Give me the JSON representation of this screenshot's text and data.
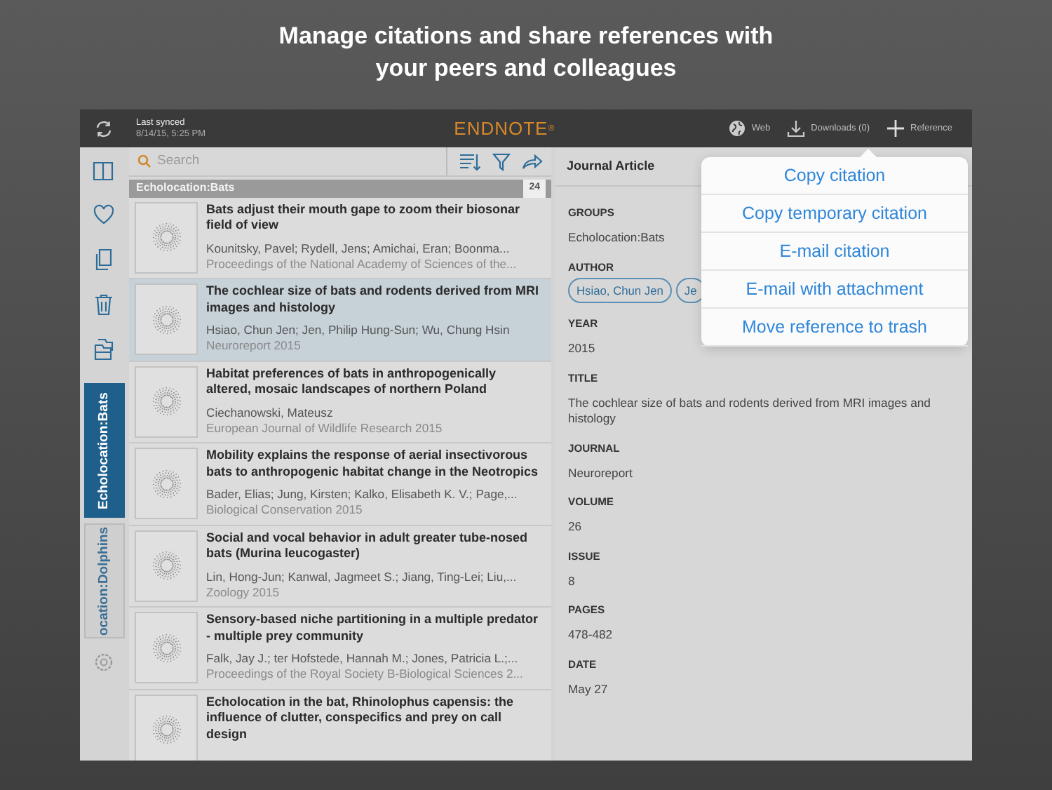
{
  "headline": "Manage citations and share references with your peers and colleagues",
  "top_bar": {
    "sync_label": "Last synced",
    "sync_time": "8/14/15, 5:25 PM",
    "logo": "ENDNOTE$^{®}$",
    "actions": [
      {
        "label": "Web",
        "kind": "web"
      },
      {
        "label": "Downloads (0)",
        "kind": "download"
      },
      {
        "label": "Reference",
        "kind": "add"
      }
    ]
  },
  "sidebar": {
    "groups": [
      {
        "label": "Echolocation:Bats",
        "selected": true
      },
      {
        "label": "ocation:Dolphins",
        "selected": false
      }
    ]
  },
  "list": {
    "search_placeholder": "Search",
    "group_title": "Echolocation:Bats",
    "count": "24",
    "references": [
      {
        "title": "Bats adjust their mouth gape to zoom their biosonar field of view",
        "authors": "Kounitsky, Pavel; Rydell, Jens; Amichai, Eran; Boonma...",
        "source": "Proceedings of the National Academy of Sciences of the...",
        "selected": false
      },
      {
        "title": "The cochlear size of bats and rodents derived from MRI images and histology",
        "authors": "Hsiao, Chun Jen; Jen, Philip Hung-Sun; Wu, Chung Hsin",
        "source": "Neuroreport 2015",
        "selected": true
      },
      {
        "title": "Habitat preferences of bats in anthropogenically altered, mosaic landscapes of northern Poland",
        "authors": "Ciechanowski, Mateusz",
        "source": "European Journal of Wildlife Research 2015",
        "selected": false
      },
      {
        "title": "Mobility explains the response of aerial insectivorous bats to anthropogenic habitat change in the Neotropics",
        "authors": "Bader, Elias; Jung, Kirsten; Kalko, Elisabeth K. V.; Page,...",
        "source": "Biological Conservation 2015",
        "selected": false
      },
      {
        "title": "Social and vocal behavior in adult greater tube-nosed bats (Murina leucogaster)",
        "authors": "Lin, Hong-Jun; Kanwal, Jagmeet S.; Jiang, Ting-Lei; Liu,...",
        "source": "Zoology 2015",
        "selected": false
      },
      {
        "title": "Sensory-based niche partitioning in a multiple predator - multiple prey community",
        "authors": "Falk, Jay J.; ter Hofstede, Hannah M.; Jones, Patricia L.;...",
        "source": "Proceedings of the Royal Society B-Biological Sciences 2...",
        "selected": false
      },
      {
        "title": "Echolocation in the bat, Rhinolophus capensis: the influence of clutter, conspecifics and prey on call design",
        "selected": false
      }
    ]
  },
  "detail": {
    "type": "Journal Article",
    "fields": [
      {
        "label": "GROUPS",
        "kind": "text",
        "value": "Echolocation:Bats"
      },
      {
        "label": "AUTHOR",
        "kind": "chips",
        "values": [
          "Hsiao, Chun Jen",
          "Je"
        ]
      },
      {
        "label": "YEAR",
        "kind": "text",
        "value": "2015"
      },
      {
        "label": "TITLE",
        "kind": "text",
        "value": "The cochlear size of bats and rodents derived from MRI images and histology"
      },
      {
        "label": "JOURNAL",
        "kind": "text",
        "value": "Neuroreport"
      },
      {
        "label": "VOLUME",
        "kind": "text",
        "value": "26"
      },
      {
        "label": "ISSUE",
        "kind": "text",
        "value": "8"
      },
      {
        "label": "PAGES",
        "kind": "text",
        "value": "478-482"
      },
      {
        "label": "DATE",
        "kind": "text",
        "value": "May 27"
      }
    ]
  },
  "share_menu": {
    "items": [
      "Copy citation",
      "Copy temporary citation",
      "E-mail citation",
      "E-mail with attachment",
      "Move reference to trash"
    ]
  }
}
